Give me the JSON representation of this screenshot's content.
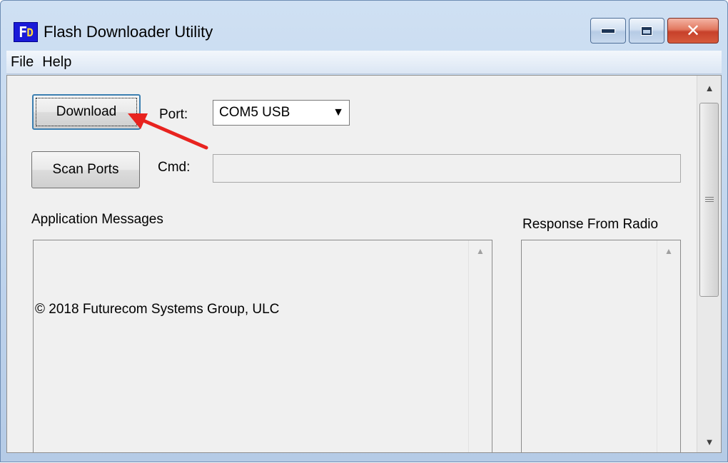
{
  "window": {
    "title": "Flash Downloader Utility",
    "icon_text_a": "F",
    "icon_text_b": "D",
    "controls": {
      "minimize": "minimize",
      "maximize": "maximize",
      "close": "✕"
    }
  },
  "menubar": {
    "items": [
      {
        "label": "File"
      },
      {
        "label": "Help"
      }
    ]
  },
  "form": {
    "download_label": "Download",
    "scan_ports_label": "Scan Ports",
    "port_label": "Port:",
    "port_value": "COM5 USB",
    "cmd_label": "Cmd:",
    "cmd_value": ""
  },
  "panels": {
    "app_messages_label": "Application Messages",
    "app_messages_text": "© 2018 Futurecom Systems Group, ULC",
    "response_label": "Response From Radio",
    "response_text": ""
  },
  "colors": {
    "annotation_arrow": "#e8231f",
    "focus_border": "#3c7fb1",
    "close_button": "#c7402a"
  },
  "icons": {
    "dropdown": "▼",
    "scroll_up": "▲",
    "scroll_down": "▼"
  }
}
